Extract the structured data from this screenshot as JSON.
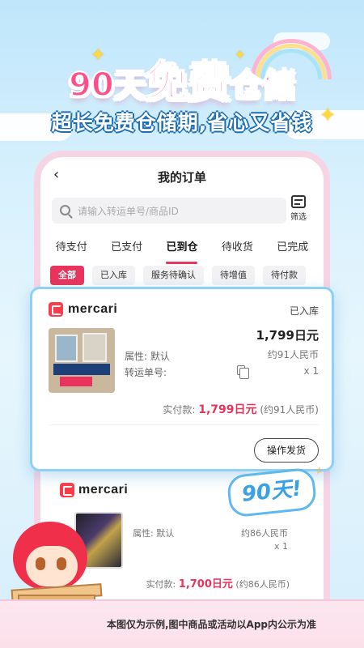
{
  "banner": {
    "headline_90": "90天",
    "headline_free": "免费",
    "headline_storage": "仓储",
    "subtitle": "超长免费仓储期,省心又省钱"
  },
  "app": {
    "title": "我的订单",
    "search": {
      "placeholder": "请输入转运单号/商品ID"
    },
    "filter_label": "筛选",
    "tabs": [
      {
        "label": "待支付",
        "active": false
      },
      {
        "label": "已支付",
        "active": false
      },
      {
        "label": "已到仓",
        "active": true
      },
      {
        "label": "待收货",
        "active": false
      },
      {
        "label": "已完成",
        "active": false
      }
    ],
    "chips": [
      {
        "label": "全部",
        "active": true
      },
      {
        "label": "已入库",
        "active": false
      },
      {
        "label": "服务待确认",
        "active": false
      },
      {
        "label": "待增值",
        "active": false
      },
      {
        "label": "待付款",
        "active": false
      }
    ]
  },
  "order_card": {
    "shop": "mercari",
    "status": "已入库",
    "attribute": "属性: 默认",
    "tracking_label": "转运单号:",
    "price": "1,799日元",
    "rmb": "约91人民币",
    "qty": "x 1",
    "paid_label": "实付款:",
    "paid_amount": "1,799日元",
    "paid_rmb": "(约91人民币)",
    "action": "操作发货"
  },
  "order_card_2": {
    "shop": "mercari",
    "attribute": "属性: 默认",
    "price": "1,700日元",
    "rmb": "约86人民币",
    "qty": "x 1",
    "paid_label": "实付款:",
    "paid_amount": "1,700日元",
    "paid_rmb": "(约86人民币)"
  },
  "badge": "90天!",
  "mascot_box_label": "楽",
  "footer": "本图仅为示例,图中商品或活动以App内公示为准",
  "colors": {
    "accent": "#e8345c",
    "headline_pink": "#ff3f82",
    "card_border": "#8fd0f5"
  }
}
